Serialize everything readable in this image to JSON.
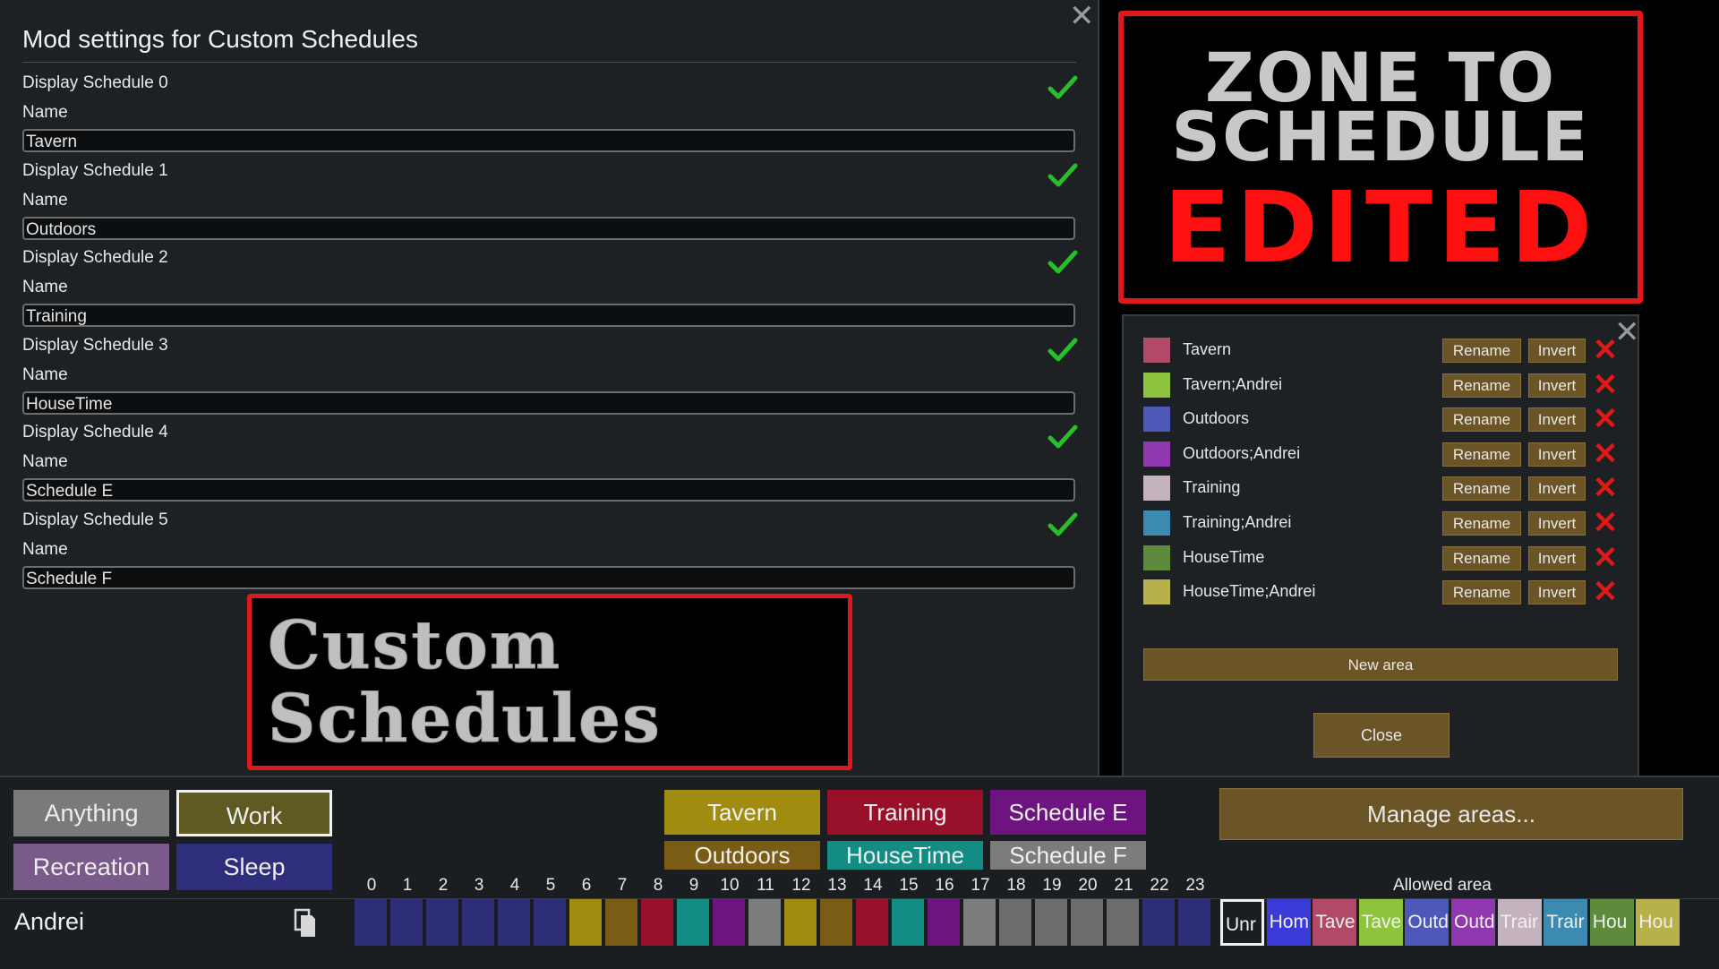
{
  "mod_settings": {
    "title": "Mod settings for Custom Schedules",
    "schedules": [
      {
        "label": "Display Schedule 0",
        "name_label": "Name",
        "name_value": "Tavern"
      },
      {
        "label": "Display Schedule 1",
        "name_label": "Name",
        "name_value": "Outdoors"
      },
      {
        "label": "Display Schedule 2",
        "name_label": "Name",
        "name_value": "Training"
      },
      {
        "label": "Display Schedule 3",
        "name_label": "Name",
        "name_value": "HouseTime"
      },
      {
        "label": "Display Schedule 4",
        "name_label": "Name",
        "name_value": "Schedule E"
      },
      {
        "label": "Display Schedule 5",
        "name_label": "Name",
        "name_value": "Schedule F"
      }
    ]
  },
  "banner_custom": {
    "line1": "Custom",
    "line2": "Schedules"
  },
  "banner_zone": {
    "line1": "ZONE TO",
    "line2": "SCHEDULE",
    "line3": "EDITED"
  },
  "areas_panel": {
    "areas": [
      {
        "name": "Tavern",
        "color": "#b04a68"
      },
      {
        "name": "Tavern;Andrei",
        "color": "#8ec43c"
      },
      {
        "name": "Outdoors",
        "color": "#4d58b8"
      },
      {
        "name": "Outdoors;Andrei",
        "color": "#9038b0"
      },
      {
        "name": "Training",
        "color": "#c4b2be"
      },
      {
        "name": "Training;Andrei",
        "color": "#3c8ab0"
      },
      {
        "name": "HouseTime",
        "color": "#5e8a3c"
      },
      {
        "name": "HouseTime;Andrei",
        "color": "#b8b04a"
      }
    ],
    "rename_label": "Rename",
    "invert_label": "Invert",
    "new_area_label": "New area",
    "close_label": "Close"
  },
  "assignments": {
    "anything": "Anything",
    "work": "Work",
    "recreation": "Recreation",
    "sleep": "Sleep"
  },
  "schedule_buttons": {
    "tavern": "Tavern",
    "training": "Training",
    "schedule_e": "Schedule E",
    "outdoors": "Outdoors",
    "housetime": "HouseTime",
    "schedule_f": "Schedule F"
  },
  "manage_areas_label": "Manage areas...",
  "allowed_area_label": "Allowed area",
  "hours": [
    "0",
    "1",
    "2",
    "3",
    "4",
    "5",
    "6",
    "7",
    "8",
    "9",
    "10",
    "11",
    "12",
    "13",
    "14",
    "15",
    "16",
    "17",
    "18",
    "19",
    "20",
    "21",
    "22",
    "23"
  ],
  "pawn": {
    "name": "Andrei",
    "schedule_colors": [
      "#2e2e78",
      "#2e2e78",
      "#2e2e78",
      "#2e2e78",
      "#2e2e78",
      "#2e2e78",
      "#a08c10",
      "#7a5c14",
      "#98102a",
      "#138c84",
      "#6e1480",
      "#7c7c7c",
      "#a08c10",
      "#7a5c14",
      "#98102a",
      "#138c84",
      "#6e1480",
      "#7c7c7c",
      "#6c6c6c",
      "#6c6c6c",
      "#6c6c6c",
      "#6c6c6c",
      "#2e2e78",
      "#2e2e78"
    ],
    "allowed_areas": [
      {
        "label": "Unr",
        "color": "#1b1e21"
      },
      {
        "label": "Hom",
        "color": "#3a3ad8"
      },
      {
        "label": "Tave",
        "color": "#b04a68"
      },
      {
        "label": "Tave",
        "color": "#8ec43c"
      },
      {
        "label": "Outd",
        "color": "#4d58b8"
      },
      {
        "label": "Outd",
        "color": "#9038b0"
      },
      {
        "label": "Trair",
        "color": "#c4b2be"
      },
      {
        "label": "Trair",
        "color": "#3c8ab0"
      },
      {
        "label": "Hou",
        "color": "#5e8a3c"
      },
      {
        "label": "Hou",
        "color": "#b8b04a"
      }
    ]
  }
}
